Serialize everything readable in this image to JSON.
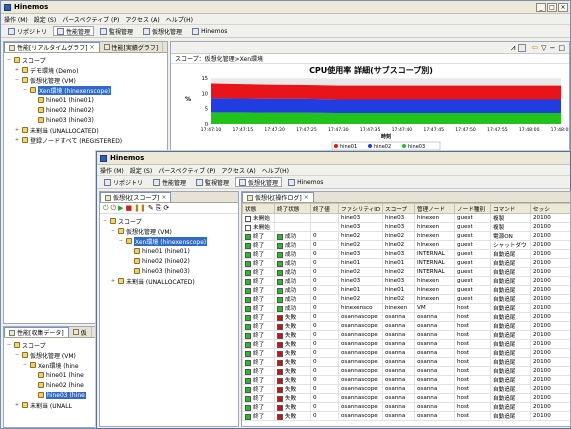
{
  "app_title": "Hinemos",
  "menu": [
    "操作 (M)",
    "設定 (S)",
    "パースペクティブ (P)",
    "アクセス (A)",
    "ヘルプ(H)"
  ],
  "win1": {
    "perspectives": [
      "リポジトリ",
      "性能管理",
      "監視管理",
      "仮想化管理",
      "Hinemos"
    ],
    "active_perspective": 1,
    "tabs_top_left": [
      "性能[リアルタイムグラフ]",
      "性能[実績グラフ]"
    ],
    "breadcrumb": "スコープ：仮想化管理>Xen環境",
    "tree": [
      {
        "label": "スコープ",
        "level": 0,
        "toggle": "−"
      },
      {
        "label": "デモ環境 (Demo)",
        "level": 1,
        "toggle": "+"
      },
      {
        "label": "仮想化管理 (VM)",
        "level": 1,
        "toggle": "−"
      },
      {
        "label": "Xen環境 (hinexenscope)",
        "level": 2,
        "toggle": "−",
        "selected": true
      },
      {
        "label": "hine01 (hine01)",
        "level": 3,
        "toggle": ""
      },
      {
        "label": "hine02 (hine02)",
        "level": 3,
        "toggle": ""
      },
      {
        "label": "hine03 (hine03)",
        "level": 3,
        "toggle": ""
      },
      {
        "label": "未割当 (UNALLOCATED)",
        "level": 1,
        "toggle": "+"
      },
      {
        "label": "登録ノードすべて (REGISTERED)",
        "level": 1,
        "toggle": "+"
      }
    ],
    "bottom_tabs": [
      "性能[収集データ]",
      "仮"
    ],
    "tree2": [
      {
        "label": "スコープ",
        "level": 0,
        "toggle": "−"
      },
      {
        "label": "仮想化管理 (VM)",
        "level": 1,
        "toggle": "−"
      },
      {
        "label": "Xen環境 (hine",
        "level": 2,
        "toggle": "−"
      },
      {
        "label": "hine01 (hine",
        "level": 3,
        "toggle": ""
      },
      {
        "label": "hine02 (hine",
        "level": 3,
        "toggle": ""
      },
      {
        "label": "hine03 (hine",
        "level": 3,
        "toggle": "",
        "selected": true
      },
      {
        "label": "未割当 (UNALL",
        "level": 1,
        "toggle": "+"
      }
    ]
  },
  "chart_data": {
    "type": "area",
    "title": "CPU使用率 詳細(サブスコープ別)",
    "ylabel": "%",
    "xlabel": "時刻",
    "ylim": [
      0,
      15
    ],
    "yticks": [
      0,
      5,
      10,
      15
    ],
    "x": [
      "17:47:10",
      "17:47:15",
      "17:47:20",
      "17:47:25",
      "17:47:30",
      "17:47:35",
      "17:47:40",
      "17:47:45",
      "17:47:50",
      "17:47:55",
      "17:48:00",
      "17:48:05"
    ],
    "series": [
      {
        "name": "hine01",
        "color": "#e8141a",
        "values": [
          4.8,
          4.7,
          4.6,
          4.5,
          4.5,
          4.5,
          4.5,
          4.5,
          4.5,
          4.5,
          4.5,
          4.5
        ]
      },
      {
        "name": "hine02",
        "color": "#1f3de0",
        "values": [
          4.6,
          4.5,
          4.5,
          4.5,
          4.4,
          4.4,
          4.4,
          4.4,
          4.4,
          4.4,
          4.4,
          4.4
        ]
      },
      {
        "name": "hine03",
        "color": "#21c21a",
        "values": [
          3.8,
          3.8,
          3.7,
          3.7,
          3.6,
          3.6,
          3.6,
          3.6,
          3.6,
          3.6,
          3.6,
          3.6
        ]
      }
    ],
    "legend": "bottom"
  },
  "win2": {
    "perspectives": [
      "リポジトリ",
      "性能管理",
      "監視管理",
      "仮想化管理",
      "Hinemos"
    ],
    "active_perspective": 3,
    "left_tab": "仮想化[スコープ]",
    "right_tab": "仮想化[操作ログ]",
    "tree": [
      {
        "label": "スコープ",
        "level": 0,
        "toggle": "−"
      },
      {
        "label": "仮想化管理 (VM)",
        "level": 1,
        "toggle": "−"
      },
      {
        "label": "Xen環境 (hinexenscope)",
        "level": 2,
        "toggle": "−",
        "selected": true
      },
      {
        "label": "hine01 (hine01)",
        "level": 3,
        "toggle": ""
      },
      {
        "label": "hine02 (hine02)",
        "level": 3,
        "toggle": ""
      },
      {
        "label": "hine03 (hine03)",
        "level": 3,
        "toggle": ""
      },
      {
        "label": "未割当 (UNALLOCATED)",
        "level": 1,
        "toggle": "+"
      }
    ],
    "columns": [
      "状態",
      "終了状態",
      "終了値",
      "ファシリティID",
      "スコープ",
      "管理ノード",
      "ノード種別",
      "コマンド",
      "セッシ"
    ],
    "rows": [
      [
        "未開始",
        "",
        "",
        "hine03",
        "hine03",
        "hinexen",
        "guest",
        "複製",
        "20100"
      ],
      [
        "未開始",
        "",
        "",
        "hine03",
        "hine03",
        "hinexen",
        "guest",
        "複製",
        "20100"
      ],
      [
        "終了",
        "成功",
        "0",
        "hine02",
        "hine02",
        "hinexen",
        "guest",
        "電源ON",
        "20100"
      ],
      [
        "終了",
        "成功",
        "0",
        "hine02",
        "hine02",
        "hinexen",
        "guest",
        "シャットダウ",
        "20100"
      ],
      [
        "終了",
        "成功",
        "0",
        "hine03",
        "hine03",
        "INTERNAL",
        "guest",
        "自動追尾",
        "20100"
      ],
      [
        "終了",
        "成功",
        "0",
        "hine01",
        "hine01",
        "INTERNAL",
        "guest",
        "自動追尾",
        "20100"
      ],
      [
        "終了",
        "成功",
        "0",
        "hine02",
        "hine02",
        "INTERNAL",
        "guest",
        "自動追尾",
        "20100"
      ],
      [
        "終了",
        "成功",
        "0",
        "hine03",
        "hine03",
        "hinexen",
        "guest",
        "自動追尾",
        "20100"
      ],
      [
        "終了",
        "成功",
        "0",
        "hine01",
        "hine01",
        "hinexen",
        "guest",
        "自動追尾",
        "20100"
      ],
      [
        "終了",
        "成功",
        "0",
        "hine02",
        "hine02",
        "hinexen",
        "guest",
        "自動追尾",
        "20100"
      ],
      [
        "終了",
        "成功",
        "0",
        "hinexensco",
        "hinexen",
        "VM",
        "host",
        "自動追尾",
        "20100"
      ],
      [
        "終了",
        "失敗",
        "0",
        "osannascope",
        "osanna",
        "osanna",
        "host",
        "自動追尾",
        "20100"
      ],
      [
        "終了",
        "失敗",
        "0",
        "osannascope",
        "osanna",
        "osanna",
        "host",
        "自動追尾",
        "20100"
      ],
      [
        "終了",
        "失敗",
        "0",
        "osannascope",
        "osanna",
        "osanna",
        "host",
        "自動追尾",
        "20100"
      ],
      [
        "終了",
        "失敗",
        "0",
        "osannascope",
        "osanna",
        "osanna",
        "host",
        "自動追尾",
        "20100"
      ],
      [
        "終了",
        "失敗",
        "0",
        "osannascope",
        "osanna",
        "osanna",
        "host",
        "自動追尾",
        "20100"
      ],
      [
        "終了",
        "失敗",
        "0",
        "osannascope",
        "osanna",
        "osanna",
        "host",
        "自動追尾",
        "20100"
      ],
      [
        "終了",
        "失敗",
        "0",
        "osannascope",
        "osanna",
        "osanna",
        "host",
        "自動追尾",
        "20100"
      ],
      [
        "終了",
        "失敗",
        "0",
        "osannascope",
        "osanna",
        "osanna",
        "host",
        "自動追尾",
        "20100"
      ],
      [
        "終了",
        "失敗",
        "0",
        "osannascope",
        "osanna",
        "osanna",
        "host",
        "自動追尾",
        "20100"
      ],
      [
        "終了",
        "失敗",
        "0",
        "osannascope",
        "osanna",
        "osanna",
        "host",
        "自動追尾",
        "20100"
      ],
      [
        "終了",
        "失敗",
        "0",
        "osannascope",
        "osanna",
        "osanna",
        "host",
        "自動追尾",
        "20100"
      ],
      [
        "終了",
        "失敗",
        "0",
        "osannascope",
        "osanna",
        "osanna",
        "host",
        "自動追尾",
        "20100"
      ]
    ]
  },
  "colors": {
    "status_done": "#20c020",
    "status_pending": "#ffffff",
    "fail": "#d01010",
    "success": "#20c020",
    "selection": "#316ac5"
  }
}
